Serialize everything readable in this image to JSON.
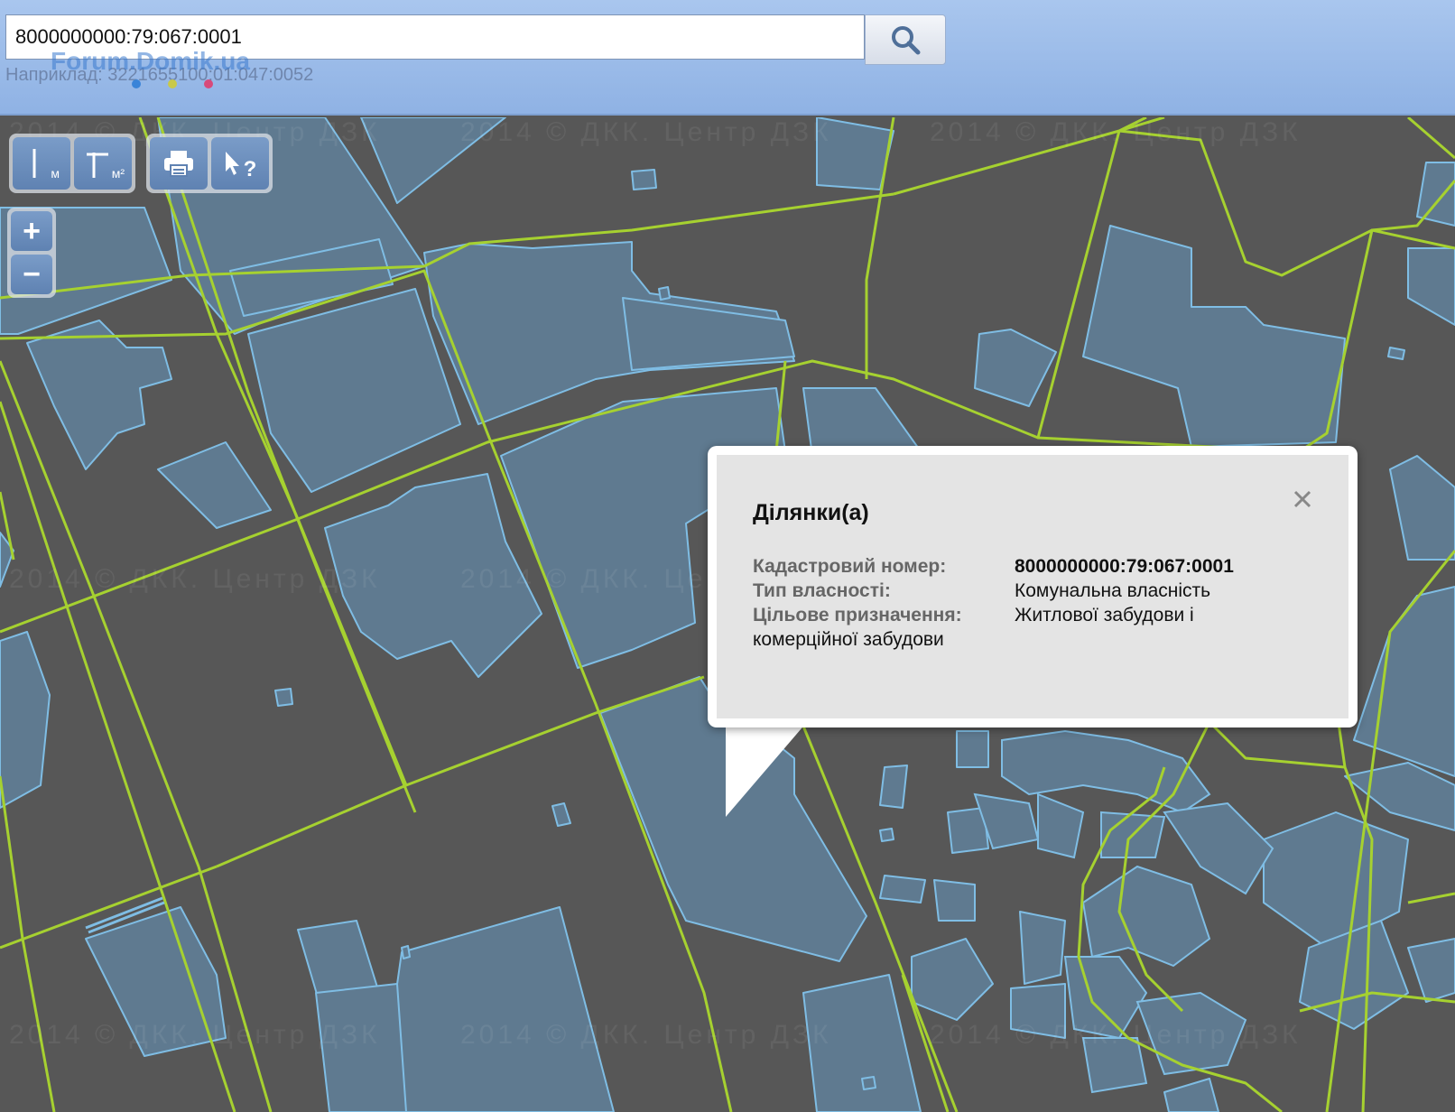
{
  "search": {
    "value": "8000000000:79:067:0001",
    "hint": "Наприклад: 3221655100:01:047:0052",
    "watermark": "Forum.Domik.ua"
  },
  "icons": {
    "search": "search-icon",
    "measure_length": "ruler-length-icon",
    "measure_area": "ruler-area-icon",
    "print": "printer-icon",
    "identify": "cursor-question-icon",
    "zoom_in": "plus-icon",
    "zoom_out": "minus-icon",
    "close": "close-icon"
  },
  "toolbar": {
    "length_unit": "м",
    "area_unit": "м²",
    "identify_mark": "?"
  },
  "zoom": {
    "in_label": "+",
    "out_label": "−"
  },
  "map": {
    "copyright": "2014 © ДКК. Центр ДЗК",
    "colors": {
      "background": "#575757",
      "parcel_border": "#a6d130",
      "building_fill": "#5f7a90",
      "building_border": "#7fbde4"
    }
  },
  "popup": {
    "title": "Ділянки(а)",
    "rows": [
      {
        "label": "Кадастровий номер:",
        "value": "8000000000:79:067:0001"
      },
      {
        "label": "Тип власності:",
        "value": "Комунальна власність"
      },
      {
        "label": "Цільове призначення:",
        "value": "Житлової забудови і"
      }
    ],
    "continuation": "комерційної забудови"
  }
}
